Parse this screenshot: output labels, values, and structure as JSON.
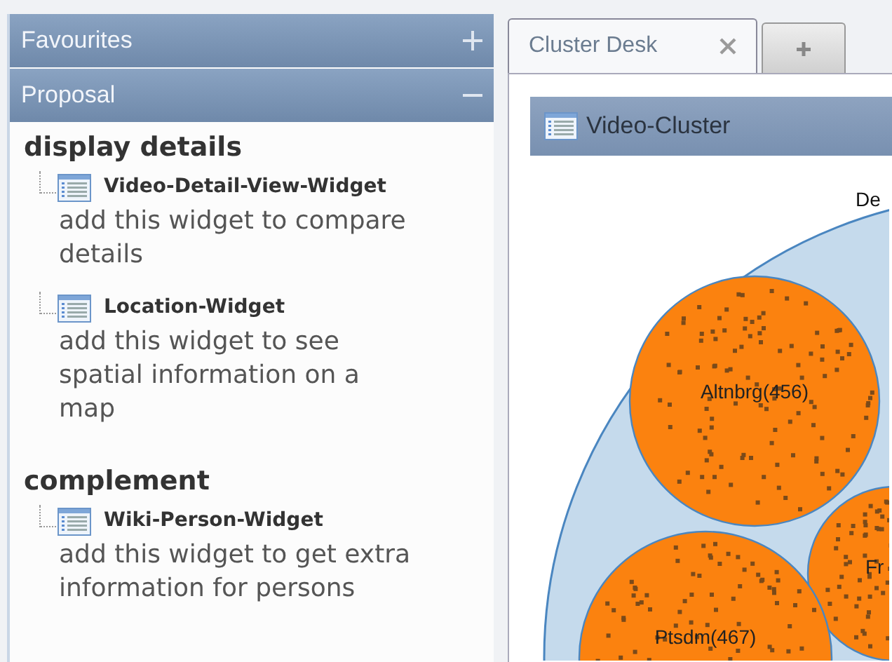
{
  "accordion": [
    {
      "title": "Favourites",
      "expanded": false
    },
    {
      "title": "Proposal",
      "expanded": true
    }
  ],
  "proposal_groups": [
    {
      "heading": "display details",
      "widgets": [
        {
          "name": "Video-Detail-View-Widget",
          "description": "add this widget to compare details"
        },
        {
          "name": "Location-Widget",
          "description": "add this widget to see spatial information on a map"
        }
      ]
    },
    {
      "heading": "complement",
      "widgets": [
        {
          "name": "Wiki-Person-Widget",
          "description": "add this widget to get extra information for persons"
        }
      ]
    }
  ],
  "tabs": [
    {
      "label": "Cluster Desk",
      "selected": true
    }
  ],
  "panel": {
    "title": "Video-Cluster"
  },
  "clusters": {
    "outer_label": "De",
    "groups": [
      {
        "label": "Altnbrg(456)"
      },
      {
        "label": "Fr"
      },
      {
        "label": "Ptsdm(467)"
      }
    ]
  }
}
